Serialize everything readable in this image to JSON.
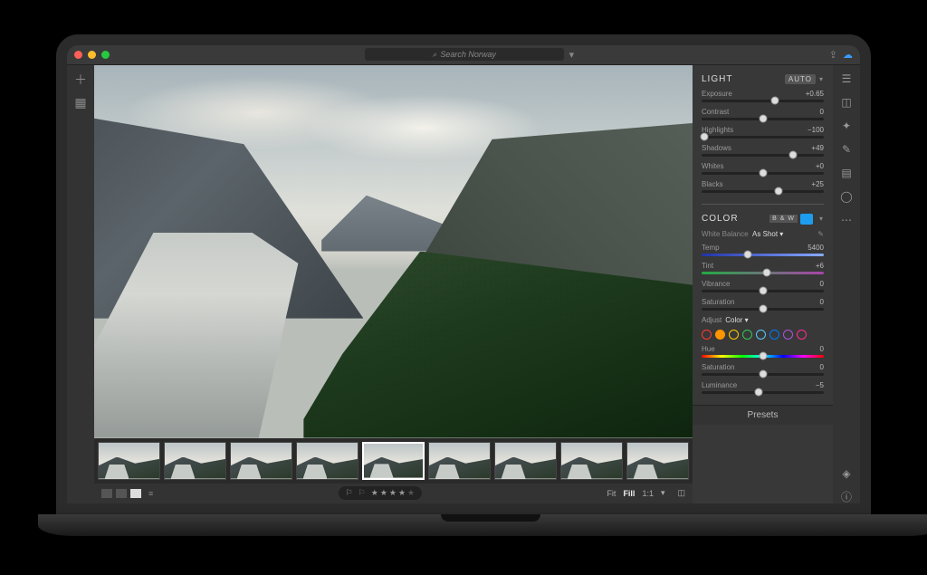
{
  "search": {
    "placeholder": "Search Norway"
  },
  "light": {
    "title": "LIGHT",
    "auto": "AUTO",
    "exposure": {
      "label": "Exposure",
      "value": "+0.65",
      "pos": 60
    },
    "contrast": {
      "label": "Contrast",
      "value": "0",
      "pos": 50
    },
    "highlights": {
      "label": "Highlights",
      "value": "−100",
      "pos": 2
    },
    "shadows": {
      "label": "Shadows",
      "value": "+49",
      "pos": 75
    },
    "whites": {
      "label": "Whites",
      "value": "+0",
      "pos": 50
    },
    "blacks": {
      "label": "Blacks",
      "value": "+25",
      "pos": 63
    }
  },
  "color": {
    "title": "COLOR",
    "bw": "B & W",
    "wb_label": "White Balance",
    "wb_value": "As Shot",
    "temp": {
      "label": "Temp",
      "value": "5400",
      "pos": 38
    },
    "tint": {
      "label": "Tint",
      "value": "+6",
      "pos": 53
    },
    "vibrance": {
      "label": "Vibrance",
      "value": "0",
      "pos": 50
    },
    "saturation": {
      "label": "Saturation",
      "value": "0",
      "pos": 50
    }
  },
  "mixer": {
    "adjust_label": "Adjust",
    "adjust_value": "Color",
    "hue": {
      "label": "Hue",
      "value": "0",
      "pos": 50
    },
    "msat": {
      "label": "Saturation",
      "value": "0",
      "pos": 50
    },
    "lum": {
      "label": "Luminance",
      "value": "−5",
      "pos": 47
    },
    "swatches": [
      "#ff3b30",
      "#ff9500",
      "#ffcc00",
      "#34c759",
      "#5ac8fa",
      "#007aff",
      "#af52de",
      "#ff2d92"
    ]
  },
  "footer": {
    "fit": "Fit",
    "fill": "Fill",
    "oneone": "1:1",
    "presets": "Presets",
    "stars": 4
  },
  "filmstrip_count": 9,
  "selected_thumb": 4
}
